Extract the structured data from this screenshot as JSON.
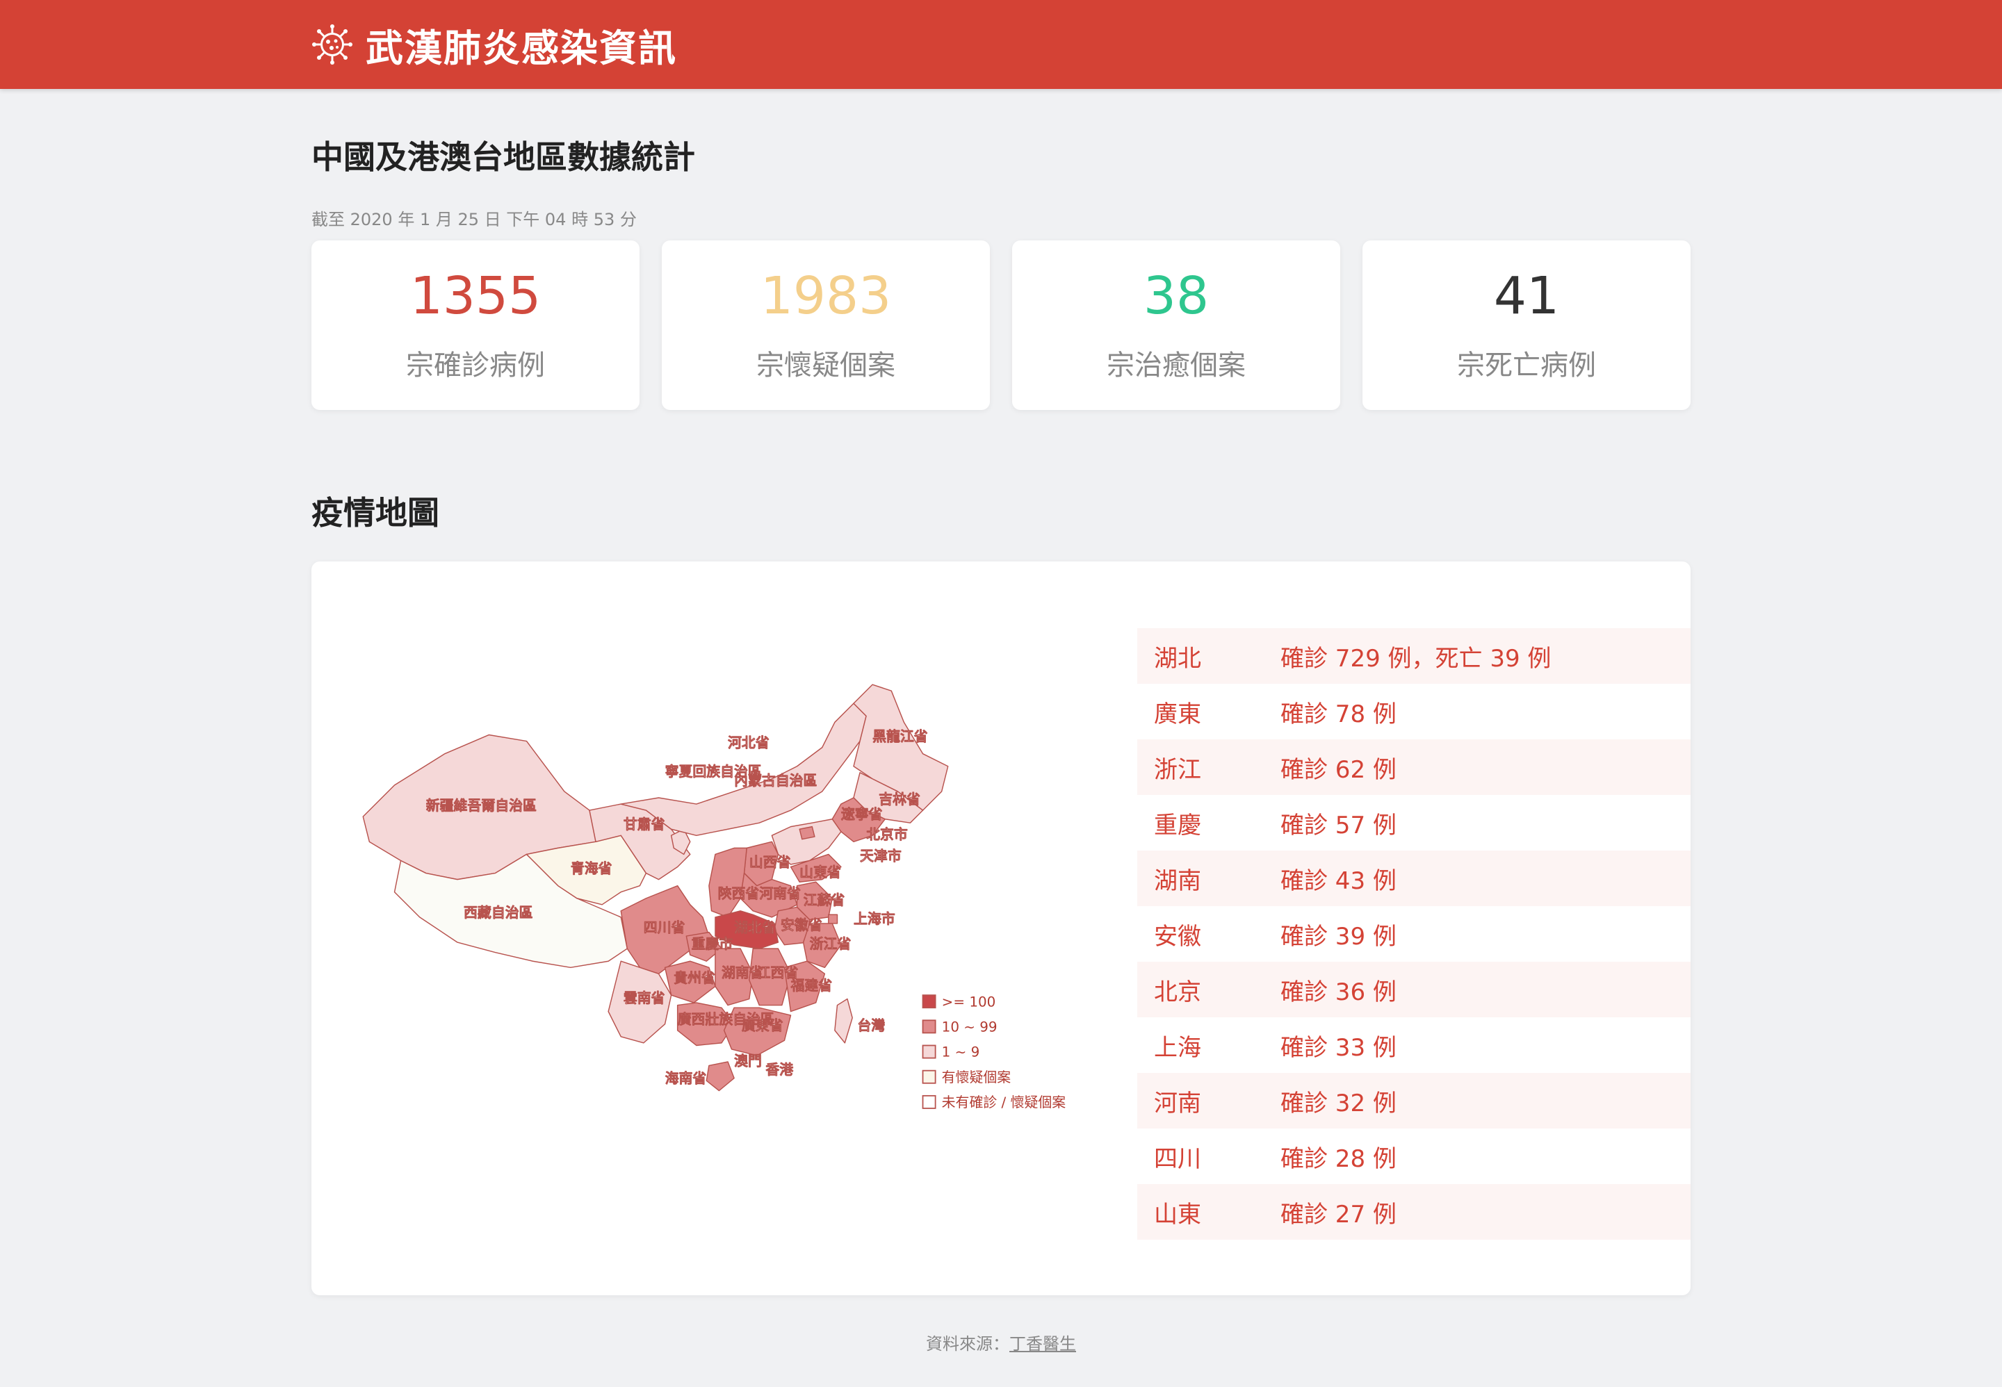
{
  "header": {
    "title": "武漢肺炎感染資訊",
    "logo_icon": "virus-icon",
    "bg_color": "#d44235"
  },
  "summary": {
    "title": "中國及港澳台地區數據統計",
    "updated": "截至 2020 年 1 月 25 日 下午 04 時 53 分",
    "stats": [
      {
        "value": "1355",
        "label": "宗確診病例",
        "color": "#d04a3e"
      },
      {
        "value": "1983",
        "label": "宗懷疑個案",
        "color": "#f4cf8b"
      },
      {
        "value": "38",
        "label": "宗治癒個案",
        "color": "#2ec68e"
      },
      {
        "value": "41",
        "label": "宗死亡病例",
        "color": "#333333"
      }
    ]
  },
  "map_section": {
    "title": "疫情地圖",
    "regions": {
      "xinjiang": "新疆維吾爾自治區",
      "xizang": "西藏自治區",
      "qinghai": "青海省",
      "gansu": "甘肅省",
      "ningxia": "寧夏回族自治區",
      "neimenggu": "內蒙古自治區",
      "heilongjiang": "黑龍江省",
      "jilin": "吉林省",
      "liaoning": "遼寧省",
      "hebei": "河北省",
      "beijing": "北京市",
      "tianjin": "天津市",
      "shanxi": "山西省",
      "shandong": "山東省",
      "henan": "河南省",
      "shaanxi": "陝西省",
      "jiangsu": "江蘇省",
      "shanghai": "上海市",
      "anhui": "安徽省",
      "hubei": "湖北省",
      "sichuan": "四川省",
      "chongqing": "重慶市",
      "zhejiang": "浙江省",
      "guizhou": "貴州省",
      "hunan": "湖南省",
      "jiangxi": "江西省",
      "fujian": "福建省",
      "yunnan": "雲南省",
      "guangxi": "廣西壯族自治區",
      "guangdong": "廣東省",
      "taiwan": "台灣",
      "hainan": "海南省",
      "macau": "澳門",
      "hongkong": "香港"
    },
    "legend": [
      {
        "label": ">= 100",
        "color": "#c9484a"
      },
      {
        "label": "10 ~ 99",
        "color": "#e08b8b"
      },
      {
        "label": "1 ~ 9",
        "color": "#f5d8d8"
      },
      {
        "label": "有懷疑個案",
        "color": "#fbf6e9"
      },
      {
        "label": "未有確診 / 懷疑個案",
        "color": "#ffffff"
      }
    ],
    "provinces": [
      {
        "name": "湖北",
        "value": "確診 729 例，死亡 39 例"
      },
      {
        "name": "廣東",
        "value": "確診 78 例"
      },
      {
        "name": "浙江",
        "value": "確診 62 例"
      },
      {
        "name": "重慶",
        "value": "確診 57 例"
      },
      {
        "name": "湖南",
        "value": "確診 43 例"
      },
      {
        "name": "安徽",
        "value": "確診 39 例"
      },
      {
        "name": "北京",
        "value": "確診 36 例"
      },
      {
        "name": "上海",
        "value": "確診 33 例"
      },
      {
        "name": "河南",
        "value": "確診 32 例"
      },
      {
        "name": "四川",
        "value": "確診 28 例"
      },
      {
        "name": "山東",
        "value": "確診 27 例"
      }
    ]
  },
  "footer": {
    "prefix": "資料來源：",
    "link": "丁香醫生"
  }
}
